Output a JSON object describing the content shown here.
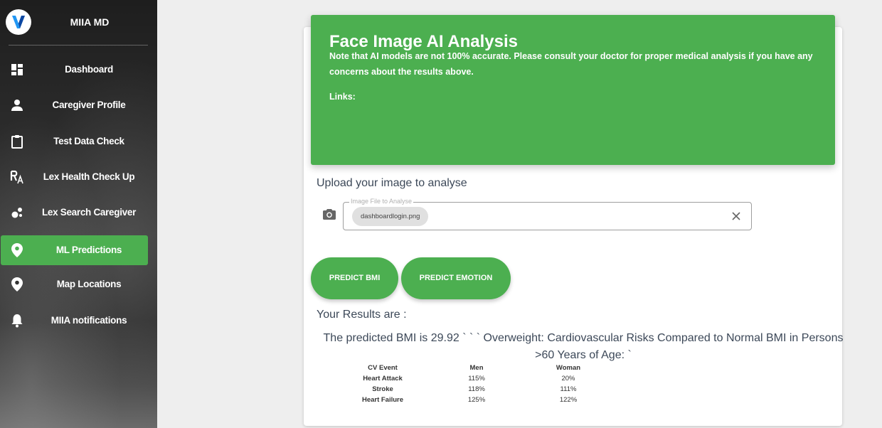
{
  "brand": {
    "name": "MIIA MD"
  },
  "sidebar": {
    "items": [
      {
        "label": "Dashboard",
        "icon": "dashboard-icon"
      },
      {
        "label": "Caregiver Profile",
        "icon": "person-icon"
      },
      {
        "label": "Test Data Check",
        "icon": "clipboard-icon"
      },
      {
        "label": "Lex Health Check Up",
        "icon": "text-format-icon"
      },
      {
        "label": "Lex Search Caregiver",
        "icon": "bubble-chart-icon"
      },
      {
        "label": "ML Predictions",
        "icon": "location-pin-icon",
        "active": true
      },
      {
        "label": "Map Locations",
        "icon": "location-pin-icon"
      },
      {
        "label": "MIIA notifications",
        "icon": "bell-icon"
      }
    ]
  },
  "header": {
    "title": "Face Image AI Analysis",
    "note": "Note that AI models are not 100% accurate. Please consult your doctor for proper medical analysis if you have any concerns about the results above.",
    "links_label": "Links:"
  },
  "upload": {
    "title": "Upload your image to analyse",
    "field_label": "Image File to Analyse",
    "file_name": "dashboardlogin.png"
  },
  "buttons": {
    "predict_bmi": "PREDICT BMI",
    "predict_emotion": "PREDICT EMOTION"
  },
  "results": {
    "title": "Your Results are :",
    "bmi_text": "The predicted BMI is 29.92 ` ` ` Overweight: Cardiovascular Risks Compared to Normal BMI in Persons >60 Years of Age: `",
    "table": {
      "headers": [
        "CV Event",
        "Men",
        "Woman"
      ],
      "rows": [
        [
          "Heart Attack",
          "115%",
          "20%"
        ],
        [
          "Stroke",
          "118%",
          "111%"
        ],
        [
          "Heart Failure",
          "125%",
          "122%"
        ]
      ]
    }
  },
  "colors": {
    "accent": "#4caf50",
    "text": "#3c4858"
  }
}
